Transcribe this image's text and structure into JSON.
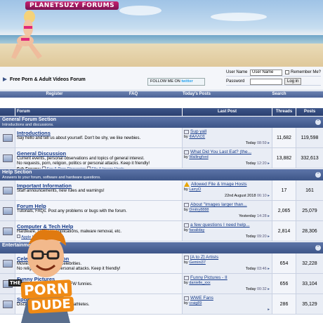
{
  "banner": {
    "logo": "PLANETSUZY FORUMS"
  },
  "header": {
    "site_name": "Free Porn & Adult Videos Forum",
    "twitter": {
      "prefix": "FOLLOW ME ON",
      "brand": "twitter"
    },
    "login": {
      "username_label": "User Name",
      "username_value": "User Name",
      "remember_label": "Remember Me?",
      "password_label": "Password",
      "button": "Log in"
    }
  },
  "nav": [
    "Register",
    "FAQ",
    "Today's Posts",
    "Search"
  ],
  "table_head": {
    "forum": "Forum",
    "last_post": "Last Post",
    "threads": "Threads",
    "posts": "Posts"
  },
  "sections": [
    {
      "title": "General Forum Section",
      "desc": "Introductions and discussions.",
      "forums": [
        {
          "name": "Introductions",
          "desc": "Say hello and tell us about yourself. Don't be shy, we like newbies.",
          "desc2": "",
          "sub_label": "",
          "subs": [],
          "last_title": "Sup yall",
          "last_by": "ΦΑΛΛΟΣ",
          "last_date": "Today",
          "last_time": "08:59",
          "threads": "11,682",
          "posts": "119,598",
          "warn": false
        },
        {
          "name": "General Discussion",
          "desc": "Current events, personal observations and topics of general interest.",
          "desc2": "No requests, porn, religion, politics or personal attacks. Keep it friendly!",
          "sub_label": "Sub-Forums:",
          "subs": [
            "Sex & Porn Discussion",
            "File & Image Hosts"
          ],
          "last_title": "What Did You Last Eat? (the...",
          "last_by": "Wallingford",
          "last_date": "Today",
          "last_time": "12:20",
          "threads": "13,882",
          "posts": "332,613",
          "warn": false
        }
      ]
    },
    {
      "title": "Help Section",
      "desc": "Answers to your forum, software and hardware questions.",
      "forums": [
        {
          "name": "Important Information",
          "desc": "Staff announcements, new rules and warnings!",
          "desc2": "",
          "sub_label": "",
          "subs": [],
          "last_title": "Allowed File & Image Hosts",
          "last_by": "LarryO",
          "last_date": "22nd August 2018",
          "last_time": "06:10",
          "threads": "17",
          "posts": "161",
          "warn": true
        },
        {
          "name": "Forum Help",
          "desc": "Tutorials, FAQs. Post any problems or bugs with the forum.",
          "desc2": "",
          "sub_label": "",
          "subs": [],
          "last_title": "About \"Images larger than...",
          "last_by": "Dmitry8888",
          "last_date": "Yesterday",
          "last_time": "14:28",
          "threads": "2,065",
          "posts": "25,079",
          "warn": false
        },
        {
          "name": "Computer & Tech Help",
          "desc": "Hardware, software, applications, malware removal, etc.",
          "desc2": "",
          "sub_label": "",
          "subs": [
            "Apple Help",
            "Linux Help"
          ],
          "last_title": "a few questions I need help...",
          "last_by": "faoaliday",
          "last_date": "Today",
          "last_time": "09:20",
          "threads": "2,814",
          "posts": "28,306",
          "warn": false
        }
      ]
    },
    {
      "title": "Entertainment",
      "desc": "",
      "forums": [
        {
          "name": "Celebrity Discussion",
          "desc": "Movies, TV, books and Celebrities.",
          "desc2": "No religion, politics or personal attacks. Keep it friendly!",
          "sub_label": "",
          "subs": [],
          "last_title": "[A to Z] Artists",
          "last_by": "Gemini37",
          "last_date": "Today",
          "last_time": "03:46",
          "threads": "654",
          "posts": "32,228",
          "warn": false
        },
        {
          "name": "Funny Pictures",
          "desc": "Jokes, memes and other NSFW funnies.",
          "desc2": "",
          "sub_label": "",
          "subs": [],
          "last_title": "Funny Pictures - II",
          "last_by": "danielle_xxx",
          "last_date": "Today",
          "last_time": "00:32",
          "threads": "656",
          "posts": "33,104",
          "warn": false
        },
        {
          "name": "Sports",
          "desc": "Discuss and share teams and athletes.",
          "desc2": "",
          "sub_label": "",
          "subs": [],
          "last_title": "WWE Fans",
          "last_by": "craig89",
          "last_date": "",
          "last_time": "",
          "threads": "286",
          "posts": "35,129",
          "warn": false
        }
      ]
    }
  ],
  "badge": {
    "the": "THE",
    "word1": "PORN",
    "word2": "DUDE"
  }
}
